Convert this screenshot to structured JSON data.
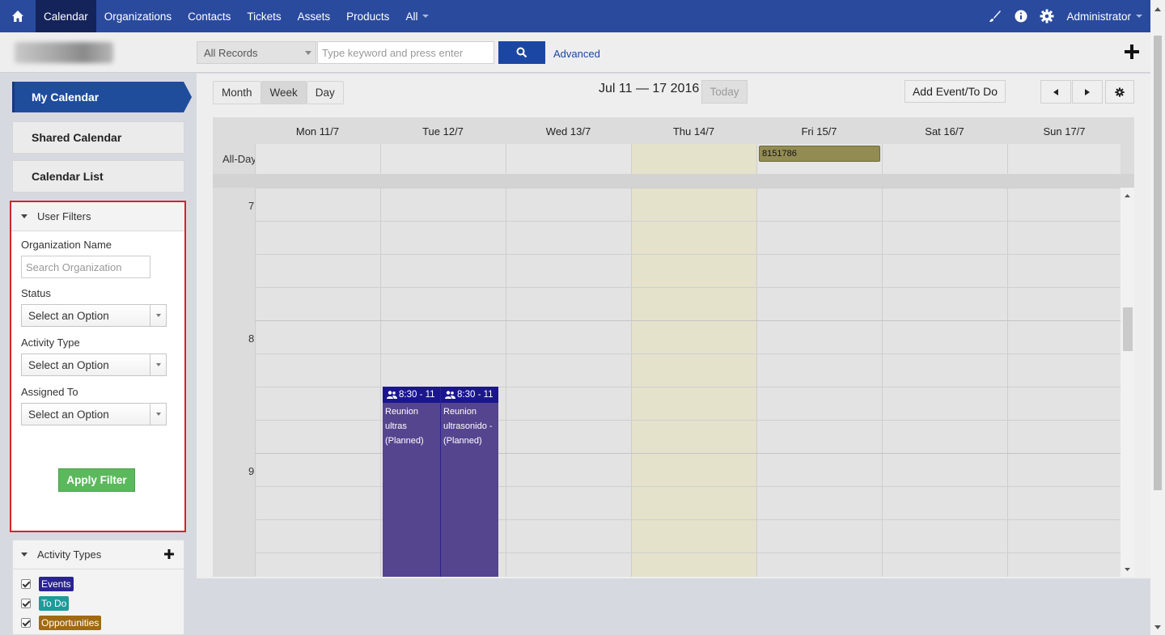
{
  "topnav": {
    "items": [
      "Calendar",
      "Organizations",
      "Contacts",
      "Tickets",
      "Assets",
      "Products",
      "All"
    ],
    "user": "Administrator"
  },
  "subbar": {
    "records_select": "All Records",
    "search_placeholder": "Type keyword and press enter",
    "advanced": "Advanced"
  },
  "sidebar": {
    "my_calendar": "My Calendar",
    "shared_calendar": "Shared Calendar",
    "calendar_list": "Calendar List"
  },
  "filters": {
    "title": "User Filters",
    "org_label": "Organization Name",
    "org_placeholder": "Search Organization",
    "status_label": "Status",
    "status_value": "Select an Option",
    "activity_label": "Activity Type",
    "activity_value": "Select an Option",
    "assigned_label": "Assigned To",
    "assigned_value": "Select an Option",
    "apply": "Apply Filter"
  },
  "activity_types": {
    "title": "Activity Types",
    "items": [
      {
        "label": "Events",
        "color": "#2a2490"
      },
      {
        "label": "To Do",
        "color": "#1f9a9a"
      },
      {
        "label": "Opportunities",
        "color": "#a06a12"
      }
    ]
  },
  "calendar": {
    "views": [
      "Month",
      "Week",
      "Day"
    ],
    "active_view": "Week",
    "range": "Jul 11 — 17 2016",
    "today": "Today",
    "add_event": "Add Event/To Do",
    "days": [
      "Mon 11/7",
      "Tue 12/7",
      "Wed 13/7",
      "Thu 14/7",
      "Fri 15/7",
      "Sat 16/7",
      "Sun 17/7"
    ],
    "allday_label": "All-Day",
    "allday_event": "8151786",
    "hours": [
      "7",
      "8",
      "9"
    ],
    "events": [
      {
        "time": "8:30 - 11",
        "text": "Reunion ultras (Planned)"
      },
      {
        "time": "8:30 - 11",
        "text": "Reunion ultrasonido - (Planned)"
      }
    ],
    "today_highlight": "#e4e2cb"
  }
}
